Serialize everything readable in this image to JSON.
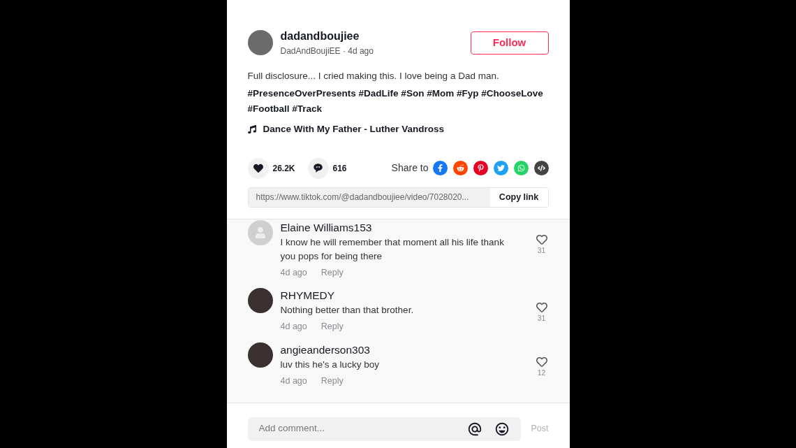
{
  "post": {
    "username": "dadandboujiee",
    "nickname": "DadAndBoujiEE · 4d ago",
    "follow_button": "Follow",
    "caption": "Full disclosure... I cried making this. I love being a Dad man.",
    "hashtags": "#PresenceOverPresents #DadLife #Son #Mom #Fyp #ChooseLove #Football #Track",
    "music": "Dance With My Father - Luther Vandross"
  },
  "stats": {
    "likes": "26.2K",
    "comments": "616"
  },
  "share": {
    "label": "Share to",
    "targets": [
      {
        "kind": "facebook",
        "color": "#1877f2"
      },
      {
        "kind": "reddit",
        "color": "#ff4500"
      },
      {
        "kind": "pinterest",
        "color": "#e60023"
      },
      {
        "kind": "twitter",
        "color": "#1da1f2"
      },
      {
        "kind": "whatsapp",
        "color": "#25d366"
      },
      {
        "kind": "embed",
        "color": "#444444"
      }
    ]
  },
  "link": {
    "url": "https://www.tiktok.com/@dadandboujiee/video/7028020...",
    "button": "Copy link"
  },
  "comments": [
    {
      "author": "Elaine Williams153",
      "kind": "default",
      "text": "I know he will remember that moment all his life thank you pops for being there",
      "time": "4d ago",
      "reply": "Reply",
      "likes": "31"
    },
    {
      "author": "RHYMEDY",
      "kind": "photo",
      "text": "Nothing better than that brother.",
      "time": "4d ago",
      "reply": "Reply",
      "likes": "31"
    },
    {
      "author": "angieanderson303",
      "kind": "photo",
      "text": "luv this he's a lucky boy",
      "time": "4d ago",
      "reply": "Reply",
      "likes": "12"
    }
  ],
  "composer": {
    "placeholder": "Add comment...",
    "post_button": "Post",
    "post_disabled": true
  }
}
